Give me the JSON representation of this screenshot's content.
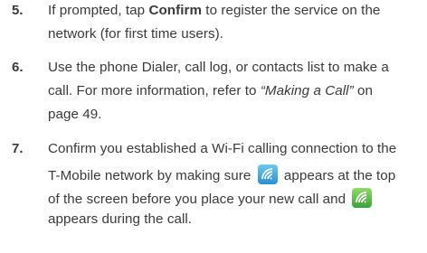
{
  "steps": [
    {
      "number": "5.",
      "lines": [
        {
          "a": "If prompted, tap ",
          "b": "Confirm",
          "c": " to register the service on the"
        },
        {
          "text": "network (for first time users)."
        }
      ]
    },
    {
      "number": "6.",
      "lines": [
        {
          "text": "Use the phone Dialer, call log, or contacts list to make a"
        },
        {
          "a": "call. For more information, refer to ",
          "b": "“Making a Call”",
          "c": " on"
        },
        {
          "text": "page 49."
        }
      ]
    },
    {
      "number": "7.",
      "lines": [
        {
          "text": "Confirm you established a Wi-Fi calling connection to the"
        },
        {
          "a": "T-Mobile network by making sure ",
          "c": " appears at the top"
        },
        {
          "a": "of the screen before you place your new call and "
        },
        {
          "text": "appears during the call."
        }
      ],
      "icons": [
        "wifi-calling-blue-icon",
        "wifi-calling-green-icon"
      ]
    }
  ]
}
